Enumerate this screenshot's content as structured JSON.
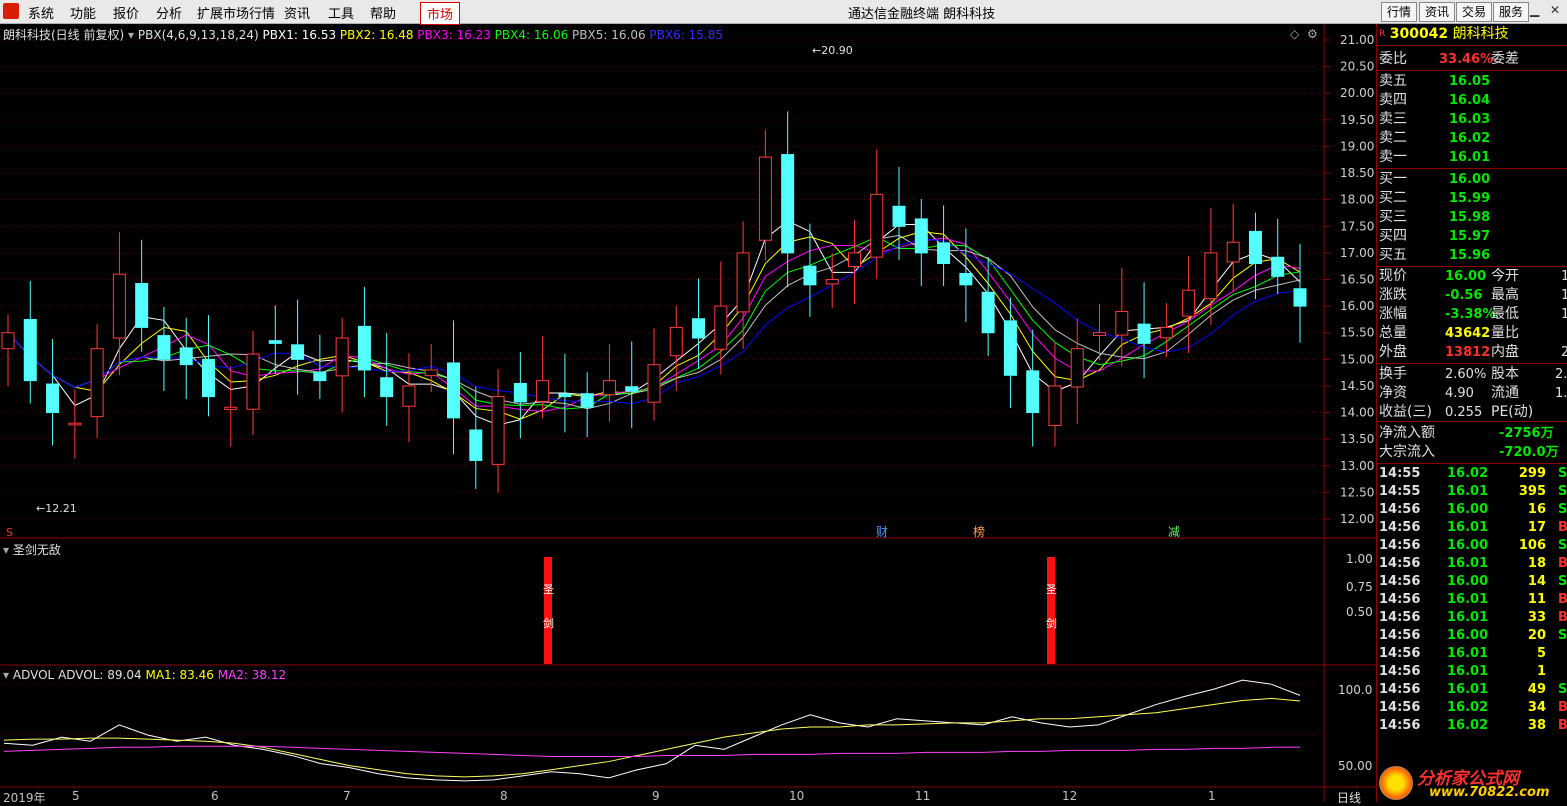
{
  "menu": {
    "items": [
      "系统",
      "功能",
      "报价",
      "分析",
      "扩展市场行情",
      "资讯",
      "工具",
      "帮助"
    ],
    "market": "市场",
    "title": "通达信金融终端  朗科科技",
    "right_buttons": [
      "行情",
      "资讯",
      "交易",
      "服务"
    ]
  },
  "main_chart": {
    "header": {
      "stock": "朗科科技(日线 前复权)",
      "indicator": "PBX(4,6,9,13,18,24)",
      "pbx1": "PBX1: 16.53",
      "pbx2": "PBX2: 16.48",
      "pbx3": "PBX3: 16.23",
      "pbx4": "PBX4: 16.06",
      "pbx5": "PBX5: 16.06",
      "pbx6": "PBX6: 15.85"
    },
    "price_axis": [
      "21.00",
      "20.50",
      "20.00",
      "19.50",
      "19.00",
      "18.50",
      "18.00",
      "17.50",
      "17.00",
      "16.50",
      "16.00",
      "15.50",
      "15.00",
      "14.50",
      "14.00",
      "13.50",
      "13.00",
      "12.50",
      "12.00"
    ],
    "high_label": "20.90",
    "low_label": "12.21",
    "markers": {
      "cai": "财",
      "bang": "榜",
      "jian": "减",
      "s": "S"
    },
    "colors": {
      "pbx1": "#ffffff",
      "pbx2": "#ffff00",
      "pbx3": "#ff00ff",
      "pbx4": "#00ff00",
      "pbx5": "#c0c0c0",
      "pbx6": "#0000ff"
    }
  },
  "signal_panel": {
    "title": "圣剑无敌",
    "axis": [
      "1.00",
      "0.75",
      "0.50"
    ],
    "bar_chars": [
      "圣",
      "剑"
    ]
  },
  "advol_panel": {
    "name": "ADVOL",
    "advol": "ADVOL: 89.04",
    "ma1": "MA1: 83.46",
    "ma2": "MA2: 38.12",
    "axis": [
      "100.0",
      "50.00"
    ]
  },
  "date_axis": [
    "2019年",
    "5",
    "6",
    "7",
    "8",
    "9",
    "10",
    "11",
    "12",
    "1"
  ],
  "period": "日线",
  "quote": {
    "code_marker": "R",
    "code": "300042",
    "name": "朗科科技",
    "weibi_label": "委比",
    "weibi": "33.46%",
    "weicha_label": "委差",
    "asks": [
      {
        "label": "卖五",
        "price": "16.05"
      },
      {
        "label": "卖四",
        "price": "16.04"
      },
      {
        "label": "卖三",
        "price": "16.03"
      },
      {
        "label": "卖二",
        "price": "16.02"
      },
      {
        "label": "卖一",
        "price": "16.01"
      }
    ],
    "bids": [
      {
        "label": "买一",
        "price": "16.00"
      },
      {
        "label": "买二",
        "price": "15.99"
      },
      {
        "label": "买三",
        "price": "15.98"
      },
      {
        "label": "买四",
        "price": "15.97"
      },
      {
        "label": "买五",
        "price": "15.96"
      }
    ],
    "stats": [
      {
        "l1": "现价",
        "v1": "16.00",
        "l2": "今开",
        "v2": "1"
      },
      {
        "l1": "涨跌",
        "v1": "-0.56",
        "l2": "最高",
        "v2": "1"
      },
      {
        "l1": "涨幅",
        "v1": "-3.38%",
        "l2": "最低",
        "v2": "1"
      },
      {
        "l1": "总量",
        "v1": "43642",
        "l2": "量比",
        "v2": ""
      },
      {
        "l1": "外盘",
        "v1": "13812",
        "l2": "内盘",
        "v2": "2"
      }
    ],
    "stats2": [
      {
        "l1": "换手",
        "v1": "2.60%",
        "l2": "股本",
        "v2": "2."
      },
      {
        "l1": "净资",
        "v1": "4.90",
        "l2": "流通",
        "v2": "1."
      },
      {
        "l1": "收益(三)",
        "v1": "0.255",
        "l2": "PE(动)",
        "v2": ""
      }
    ],
    "flows": [
      {
        "label": "净流入额",
        "value": "-2756万"
      },
      {
        "label": "大宗流入",
        "value": "-720.0万"
      }
    ],
    "ticks": [
      {
        "t": "14:55",
        "p": "16.02",
        "v": "299",
        "s": "S"
      },
      {
        "t": "14:55",
        "p": "16.01",
        "v": "395",
        "s": "S"
      },
      {
        "t": "14:56",
        "p": "16.00",
        "v": "16",
        "s": "S"
      },
      {
        "t": "14:56",
        "p": "16.01",
        "v": "17",
        "s": "B"
      },
      {
        "t": "14:56",
        "p": "16.00",
        "v": "106",
        "s": "S"
      },
      {
        "t": "14:56",
        "p": "16.01",
        "v": "18",
        "s": "B"
      },
      {
        "t": "14:56",
        "p": "16.00",
        "v": "14",
        "s": "S"
      },
      {
        "t": "14:56",
        "p": "16.01",
        "v": "11",
        "s": "B"
      },
      {
        "t": "14:56",
        "p": "16.01",
        "v": "33",
        "s": "B"
      },
      {
        "t": "14:56",
        "p": "16.00",
        "v": "20",
        "s": "S"
      },
      {
        "t": "14:56",
        "p": "16.01",
        "v": "5",
        "s": ""
      },
      {
        "t": "14:56",
        "p": "16.01",
        "v": "1",
        "s": ""
      },
      {
        "t": "14:56",
        "p": "16.01",
        "v": "49",
        "s": "S"
      },
      {
        "t": "14:56",
        "p": "16.02",
        "v": "34",
        "s": "B"
      },
      {
        "t": "14:56",
        "p": "16.02",
        "v": "38",
        "s": "B"
      }
    ],
    "watermark": "分析家公式网",
    "watermark_url": "www.70822.com"
  },
  "chart_data": [
    {
      "type": "candlestick",
      "title": "朗科科技(日线 前复权)",
      "ylim": [
        12.0,
        21.0
      ],
      "close_approx": [
        15.5,
        14.6,
        14.0,
        13.8,
        15.2,
        16.6,
        15.6,
        15.0,
        14.9,
        14.3,
        14.1,
        15.1,
        15.3,
        15.0,
        14.6,
        15.4,
        14.8,
        14.3,
        14.5,
        14.8,
        13.9,
        13.1,
        14.3,
        14.2,
        14.6,
        14.3,
        14.1,
        14.6,
        14.4,
        14.9,
        15.6,
        15.4,
        16.0,
        17.0,
        18.8,
        17.0,
        16.4,
        16.5,
        17.0,
        18.1,
        17.5,
        17.0,
        16.8,
        16.4,
        15.5,
        14.7,
        14.0,
        14.5,
        15.2,
        15.5,
        15.9,
        15.3,
        15.6,
        16.3,
        17.0,
        17.2,
        16.8,
        16.56,
        16.0
      ],
      "series": [
        {
          "name": "PBX1",
          "last": 16.53
        },
        {
          "name": "PBX2",
          "last": 16.48
        },
        {
          "name": "PBX3",
          "last": 16.23
        },
        {
          "name": "PBX4",
          "last": 16.06
        },
        {
          "name": "PBX5",
          "last": 16.06
        },
        {
          "name": "PBX6",
          "last": 15.85
        }
      ]
    },
    {
      "type": "line",
      "title": "ADVOL",
      "ylim": [
        0,
        110
      ],
      "series": [
        {
          "name": "ADVOL",
          "values": [
            42,
            40,
            48,
            44,
            60,
            50,
            44,
            48,
            40,
            36,
            30,
            22,
            18,
            12,
            8,
            6,
            5,
            6,
            10,
            14,
            12,
            8,
            16,
            22,
            40,
            36,
            48,
            60,
            70,
            62,
            58,
            66,
            64,
            62,
            60,
            68,
            62,
            58,
            60,
            70,
            80,
            88,
            95,
            104,
            100,
            89
          ]
        },
        {
          "name": "MA1",
          "values": [
            45,
            46,
            46,
            47,
            47,
            46,
            45,
            44,
            42,
            38,
            32,
            26,
            20,
            16,
            12,
            10,
            9,
            10,
            12,
            16,
            20,
            24,
            30,
            36,
            42,
            48,
            52,
            56,
            58,
            58,
            60,
            60,
            61,
            62,
            62,
            64,
            66,
            66,
            68,
            70,
            72,
            76,
            80,
            84,
            86,
            83.46
          ]
        },
        {
          "name": "MA2",
          "values": [
            34,
            35,
            36,
            37,
            38,
            38,
            39,
            39,
            39,
            39,
            38,
            37,
            36,
            35,
            34,
            33,
            32,
            31,
            30,
            29,
            29,
            29,
            29,
            30,
            30,
            30,
            31,
            31,
            31,
            32,
            32,
            32,
            33,
            33,
            33,
            34,
            34,
            35,
            35,
            35,
            36,
            36,
            37,
            37,
            38,
            38.12
          ]
        }
      ]
    }
  ]
}
